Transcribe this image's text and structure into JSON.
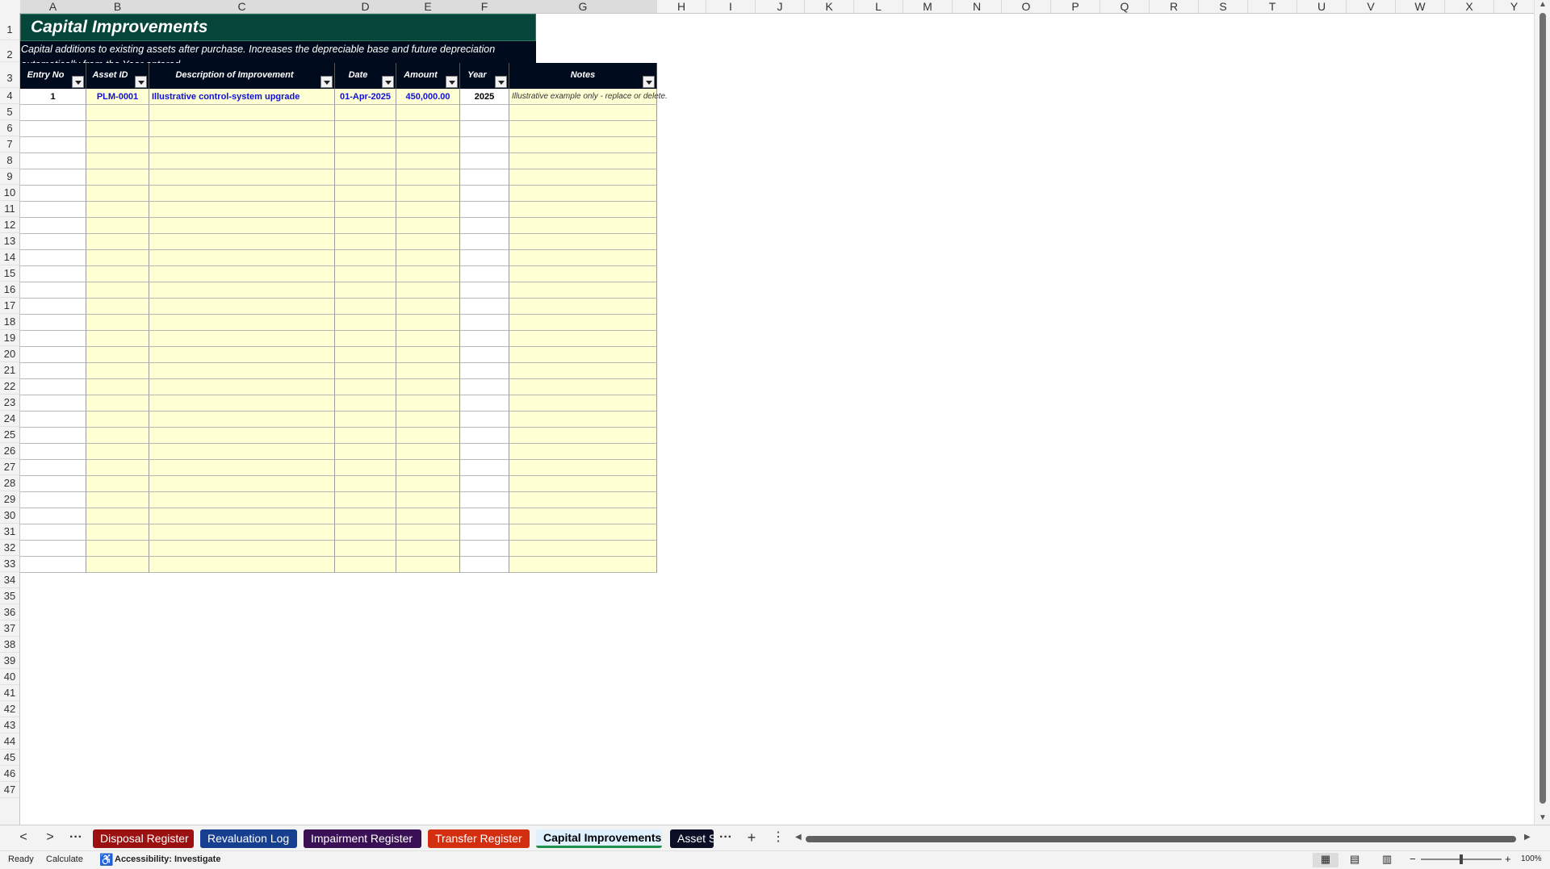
{
  "columns": [
    "A",
    "B",
    "C",
    "D",
    "E",
    "F",
    "G",
    "H",
    "I",
    "J",
    "K",
    "L",
    "M",
    "N",
    "O",
    "P",
    "Q",
    "R",
    "S",
    "T",
    "U",
    "V",
    "W",
    "X",
    "Y"
  ],
  "rows": [
    "1",
    "2",
    "3",
    "4",
    "5",
    "6",
    "7",
    "8",
    "9",
    "10",
    "11",
    "12",
    "13",
    "14",
    "15",
    "16",
    "17",
    "18",
    "19",
    "20",
    "21",
    "22",
    "23",
    "24",
    "25",
    "26",
    "27",
    "28",
    "29",
    "30",
    "31",
    "32",
    "33",
    "34",
    "35",
    "36",
    "37",
    "38",
    "39",
    "40",
    "41",
    "42",
    "43",
    "44",
    "45",
    "46",
    "47"
  ],
  "sheet": {
    "title": "Capital Improvements",
    "subtitle": "Capital additions to existing assets after purchase. Increases the depreciable base and future depreciation automatically from the Year entered.",
    "headers": [
      "Entry No",
      "Asset ID",
      "Description of Improvement",
      "Date",
      "Amount",
      "Year",
      "Notes"
    ],
    "row1": {
      "entry_no": "1",
      "asset_id": "PLM-0001",
      "description": "Illustrative control-system upgrade",
      "date": "01-Apr-2025",
      "amount": "450,000.00",
      "year": "2025",
      "notes": "Illustrative example only - replace or delete."
    }
  },
  "tabs": {
    "prev": "<",
    "next": ">",
    "more": "···",
    "add": "+",
    "options": "⋮",
    "items": [
      {
        "label": "Disposal Register",
        "color": "#9b1010",
        "active": false
      },
      {
        "label": "Revaluation Log",
        "color": "#173f8f",
        "active": false
      },
      {
        "label": "Impairment Register",
        "color": "#3b0f55",
        "active": false
      },
      {
        "label": "Transfer Register",
        "color": "#d42e10",
        "active": false
      },
      {
        "label": "Capital Improvements",
        "color": "#dff0ff",
        "active": true
      },
      {
        "label": "Asset S",
        "color": "#0a0f25",
        "active": false
      }
    ]
  },
  "status": {
    "ready": "Ready",
    "calculate": "Calculate",
    "accessibility": "Accessibility: Investigate",
    "zoom": "100%",
    "zoom_minus": "−",
    "zoom_plus": "+"
  }
}
